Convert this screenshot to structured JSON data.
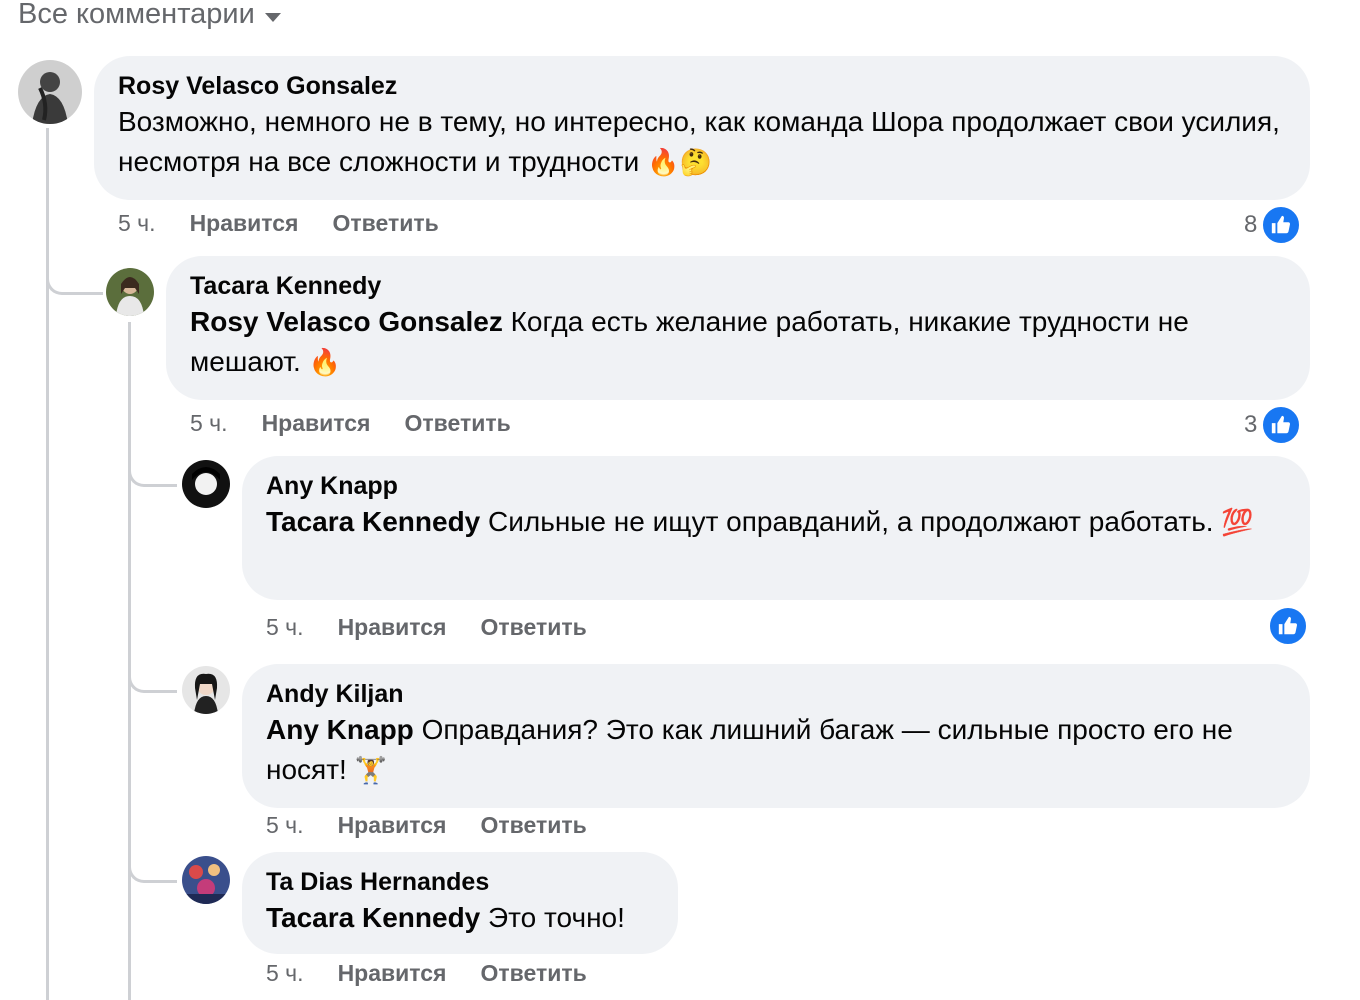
{
  "filter": {
    "label": "Все комментарии"
  },
  "comments": [
    {
      "author": "Rosy Velasco Gonsalez",
      "mention": "",
      "text": "Возможно, немного не в тему, но интересно, как команда Шора продолжает свои усилия, несмотря на все сложности и трудности",
      "emoji": "🔥🤔",
      "time": "5 ч.",
      "like_label": "Нравится",
      "reply_label": "Ответить",
      "reactions": "8"
    },
    {
      "author": "Tacara Kennedy",
      "mention": "Rosy Velasco Gonsalez",
      "text": "Когда есть желание работать, никакие трудности не мешают.",
      "emoji": "🔥",
      "time": "5 ч.",
      "like_label": "Нравится",
      "reply_label": "Ответить",
      "reactions": "3"
    },
    {
      "author": "Any Knapp",
      "mention": "Tacara Kennedy",
      "text": "Сильные не ищут оправданий, а продолжают работать.",
      "emoji": "💯",
      "time": "5 ч.",
      "like_label": "Нравится",
      "reply_label": "Ответить",
      "reactions": ""
    },
    {
      "author": "Andy Kiljan",
      "mention": "Any Knapp",
      "text": "Оправдания? Это как лишний багаж — сильные просто его не носят!",
      "emoji": "🏋️",
      "time": "5 ч.",
      "like_label": "Нравится",
      "reply_label": "Ответить",
      "reactions": ""
    },
    {
      "author": "Ta Dias Hernandes",
      "mention": "Tacara Kennedy",
      "text": "Это точно!",
      "emoji": "",
      "time": "5 ч.",
      "like_label": "Нравится",
      "reply_label": "Ответить",
      "reactions": ""
    }
  ],
  "colors": {
    "like_blue": "#1877f2",
    "bubble": "#f0f2f5",
    "meta": "#65676b"
  }
}
